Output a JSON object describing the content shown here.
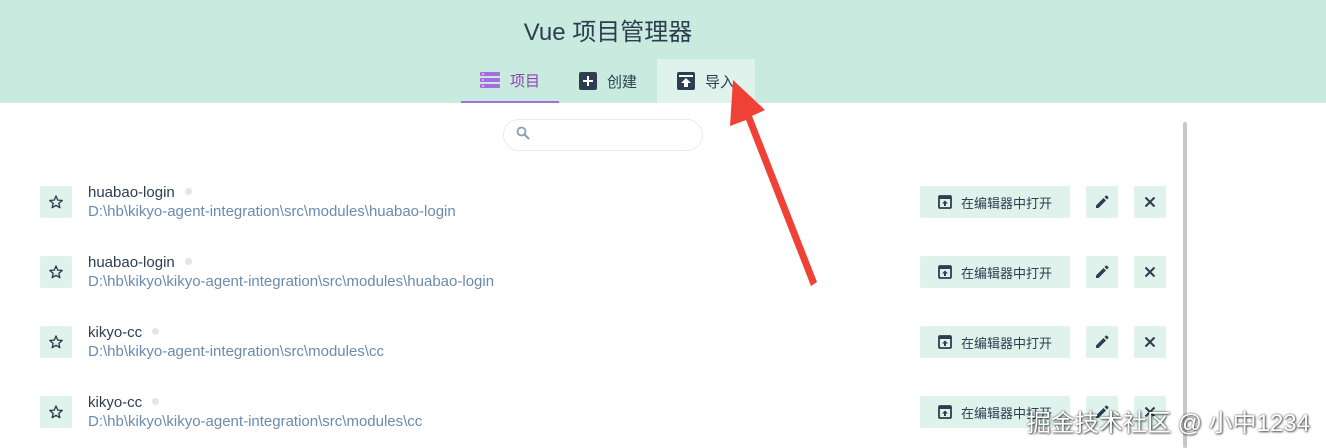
{
  "app": {
    "title": "Vue 项目管理器"
  },
  "tabs": [
    {
      "label": "项目",
      "icon": "list-icon",
      "active": true
    },
    {
      "label": "创建",
      "icon": "plus-icon",
      "active": false
    },
    {
      "label": "导入",
      "icon": "import-icon",
      "active": false,
      "hovered": true
    }
  ],
  "search": {
    "placeholder": "",
    "value": ""
  },
  "projects": [
    {
      "name": "huabao-login",
      "path": "D:\\hb\\kikyo-agent-integration\\src\\modules\\huabao-login",
      "open_label": "在编辑器中打开"
    },
    {
      "name": "huabao-login",
      "path": "D:\\hb\\kikyo\\kikyo-agent-integration\\src\\modules\\huabao-login",
      "open_label": "在编辑器中打开"
    },
    {
      "name": "kikyo-cc",
      "path": "D:\\hb\\kikyo-agent-integration\\src\\modules\\cc",
      "open_label": "在编辑器中打开"
    },
    {
      "name": "kikyo-cc",
      "path": "D:\\hb\\kikyo\\kikyo-agent-integration\\src\\modules\\cc",
      "open_label": "在编辑器中打开"
    }
  ],
  "watermark": "掘金技术社区 @ 小中1234",
  "colors": {
    "header_bg": "#c9eadf",
    "accent": "#8e44ad",
    "button_bg": "#dff3ec",
    "path_text": "#6a8bad",
    "arrow": "#ef4135"
  }
}
